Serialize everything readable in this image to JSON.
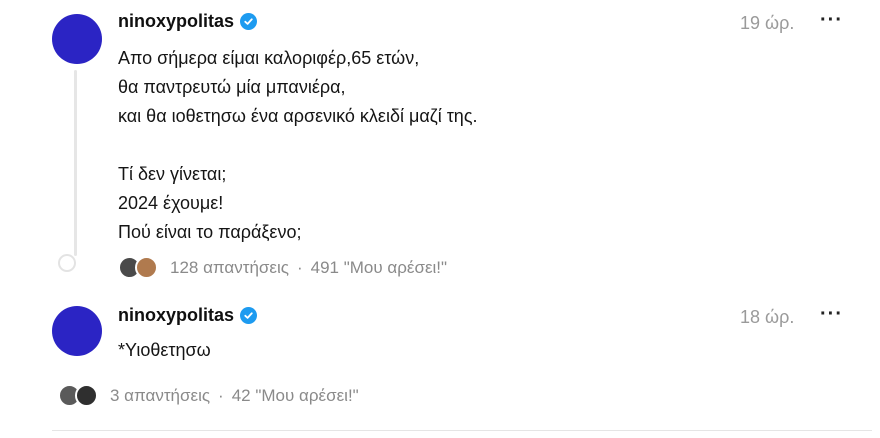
{
  "posts": [
    {
      "username": "ninoxypolitas",
      "time": "19 ώρ.",
      "lines": [
        "Απο σήμερα είμαι καλοριφέρ,65 ετών,",
        "θα παντρευτώ μία μπανιέρα,",
        "και θα ιοθετησω ένα αρσενικό κλειδί μαζί της.",
        "",
        "Τί δεν γίνεται;",
        "2024 έχουμε!",
        "Πού είναι το παράξενο;"
      ],
      "replies": "128 απαντήσεις",
      "likes": "491 \"Μου αρέσει!\""
    },
    {
      "username": "ninoxypolitas",
      "time": "18 ώρ.",
      "lines": [
        "*Υιοθετησω"
      ],
      "replies": "3 απαντήσεις",
      "likes": "42 \"Μου αρέσει!\""
    }
  ],
  "more_label": "···",
  "separator": "·",
  "colors": {
    "avatar": "#2b24c4",
    "verified": "#1d9bf0",
    "muted": "#9a9a9a"
  },
  "icons": {
    "verified": "verified-check-icon",
    "more": "more-options-icon"
  }
}
